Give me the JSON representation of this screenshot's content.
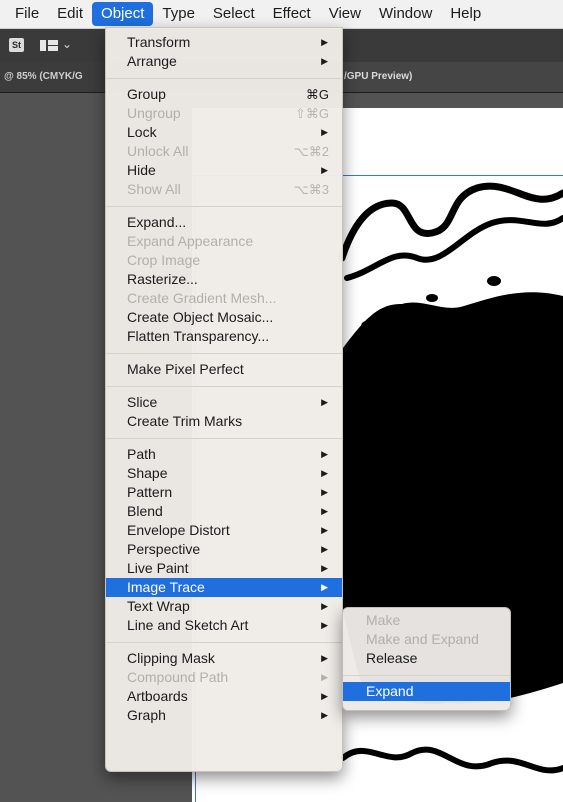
{
  "menubar": {
    "items": [
      "File",
      "Edit",
      "Object",
      "Type",
      "Select",
      "Effect",
      "View",
      "Window",
      "Help"
    ],
    "active_index": 2
  },
  "toolbar": {
    "st_label": "St",
    "chevron": "⌄"
  },
  "tabs": {
    "left": "@ 85% (CMYK/G",
    "right": "/GPU Preview)"
  },
  "object_menu": {
    "groups": [
      [
        {
          "label": "Transform",
          "shortcut": "",
          "submenu": true,
          "enabled": true
        },
        {
          "label": "Arrange",
          "shortcut": "",
          "submenu": true,
          "enabled": true
        }
      ],
      [
        {
          "label": "Group",
          "shortcut": "⌘G",
          "submenu": false,
          "enabled": true
        },
        {
          "label": "Ungroup",
          "shortcut": "⇧⌘G",
          "submenu": false,
          "enabled": false
        },
        {
          "label": "Lock",
          "shortcut": "",
          "submenu": true,
          "enabled": true
        },
        {
          "label": "Unlock All",
          "shortcut": "⌥⌘2",
          "submenu": false,
          "enabled": false
        },
        {
          "label": "Hide",
          "shortcut": "",
          "submenu": true,
          "enabled": true
        },
        {
          "label": "Show All",
          "shortcut": "⌥⌘3",
          "submenu": false,
          "enabled": false
        }
      ],
      [
        {
          "label": "Expand...",
          "shortcut": "",
          "submenu": false,
          "enabled": true
        },
        {
          "label": "Expand Appearance",
          "shortcut": "",
          "submenu": false,
          "enabled": false
        },
        {
          "label": "Crop Image",
          "shortcut": "",
          "submenu": false,
          "enabled": false
        },
        {
          "label": "Rasterize...",
          "shortcut": "",
          "submenu": false,
          "enabled": true
        },
        {
          "label": "Create Gradient Mesh...",
          "shortcut": "",
          "submenu": false,
          "enabled": false
        },
        {
          "label": "Create Object Mosaic...",
          "shortcut": "",
          "submenu": false,
          "enabled": true
        },
        {
          "label": "Flatten Transparency...",
          "shortcut": "",
          "submenu": false,
          "enabled": true
        }
      ],
      [
        {
          "label": "Make Pixel Perfect",
          "shortcut": "",
          "submenu": false,
          "enabled": true
        }
      ],
      [
        {
          "label": "Slice",
          "shortcut": "",
          "submenu": true,
          "enabled": true
        },
        {
          "label": "Create Trim Marks",
          "shortcut": "",
          "submenu": false,
          "enabled": true
        }
      ],
      [
        {
          "label": "Path",
          "shortcut": "",
          "submenu": true,
          "enabled": true
        },
        {
          "label": "Shape",
          "shortcut": "",
          "submenu": true,
          "enabled": true
        },
        {
          "label": "Pattern",
          "shortcut": "",
          "submenu": true,
          "enabled": true
        },
        {
          "label": "Blend",
          "shortcut": "",
          "submenu": true,
          "enabled": true
        },
        {
          "label": "Envelope Distort",
          "shortcut": "",
          "submenu": true,
          "enabled": true
        },
        {
          "label": "Perspective",
          "shortcut": "",
          "submenu": true,
          "enabled": true
        },
        {
          "label": "Live Paint",
          "shortcut": "",
          "submenu": true,
          "enabled": true
        },
        {
          "label": "Image Trace",
          "shortcut": "",
          "submenu": true,
          "enabled": true,
          "highlighted": true
        },
        {
          "label": "Text Wrap",
          "shortcut": "",
          "submenu": true,
          "enabled": true
        },
        {
          "label": "Line and Sketch Art",
          "shortcut": "",
          "submenu": true,
          "enabled": true
        }
      ],
      [
        {
          "label": "Clipping Mask",
          "shortcut": "",
          "submenu": true,
          "enabled": true
        },
        {
          "label": "Compound Path",
          "shortcut": "",
          "submenu": true,
          "enabled": false
        },
        {
          "label": "Artboards",
          "shortcut": "",
          "submenu": true,
          "enabled": true
        },
        {
          "label": "Graph",
          "shortcut": "",
          "submenu": true,
          "enabled": true
        }
      ]
    ]
  },
  "image_trace_submenu": {
    "groups": [
      [
        {
          "label": "Make",
          "enabled": false
        },
        {
          "label": "Make and Expand",
          "enabled": false
        },
        {
          "label": "Release",
          "enabled": true
        }
      ],
      [
        {
          "label": "Expand",
          "enabled": true,
          "highlighted": true
        }
      ]
    ]
  },
  "icons": {
    "submenu_arrow": "▶",
    "workspace_switcher": "workspace-icon"
  },
  "colors": {
    "accent": "#1f6fde",
    "artwork": "#000000",
    "artboard": "#ffffff",
    "canvas": "#535353",
    "selection": "#3a78d8"
  }
}
